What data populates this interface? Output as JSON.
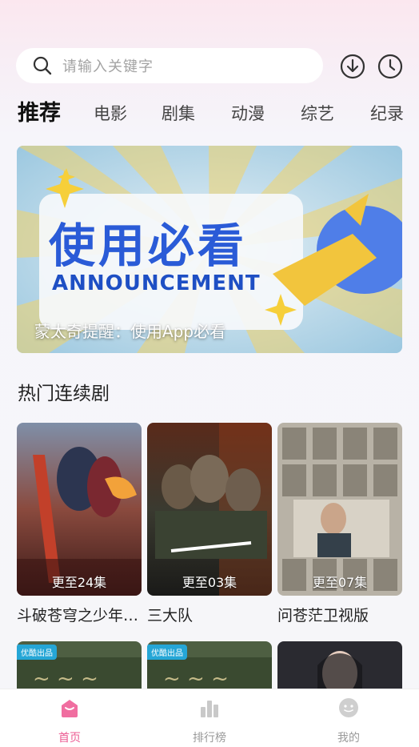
{
  "search": {
    "placeholder": "请输入关键字"
  },
  "tabs": [
    {
      "label": "推荐",
      "active": true
    },
    {
      "label": "电影"
    },
    {
      "label": "剧集"
    },
    {
      "label": "动漫"
    },
    {
      "label": "综艺"
    },
    {
      "label": "纪录"
    }
  ],
  "banner": {
    "title": "使用必看",
    "subtitle": "ANNOUNCEMENT",
    "caption": "蒙太奇提醒：使用App必看"
  },
  "section": {
    "title": "热门连续剧"
  },
  "cards": [
    {
      "name": "斗破苍穹之少年…",
      "update": "更至24集"
    },
    {
      "name": "三大队",
      "update": "更至03集"
    },
    {
      "name": "问苍茫卫视版",
      "update": "更至07集"
    }
  ],
  "row2": [
    {
      "badge": "优酷出品"
    },
    {
      "badge": "优酷出品"
    },
    {
      "badge": ""
    }
  ],
  "nav": [
    {
      "label": "首页",
      "active": true
    },
    {
      "label": "排行榜"
    },
    {
      "label": "我的"
    }
  ],
  "colors": {
    "accent": "#ec5c93",
    "banner_blue": "#2a5bd7"
  }
}
